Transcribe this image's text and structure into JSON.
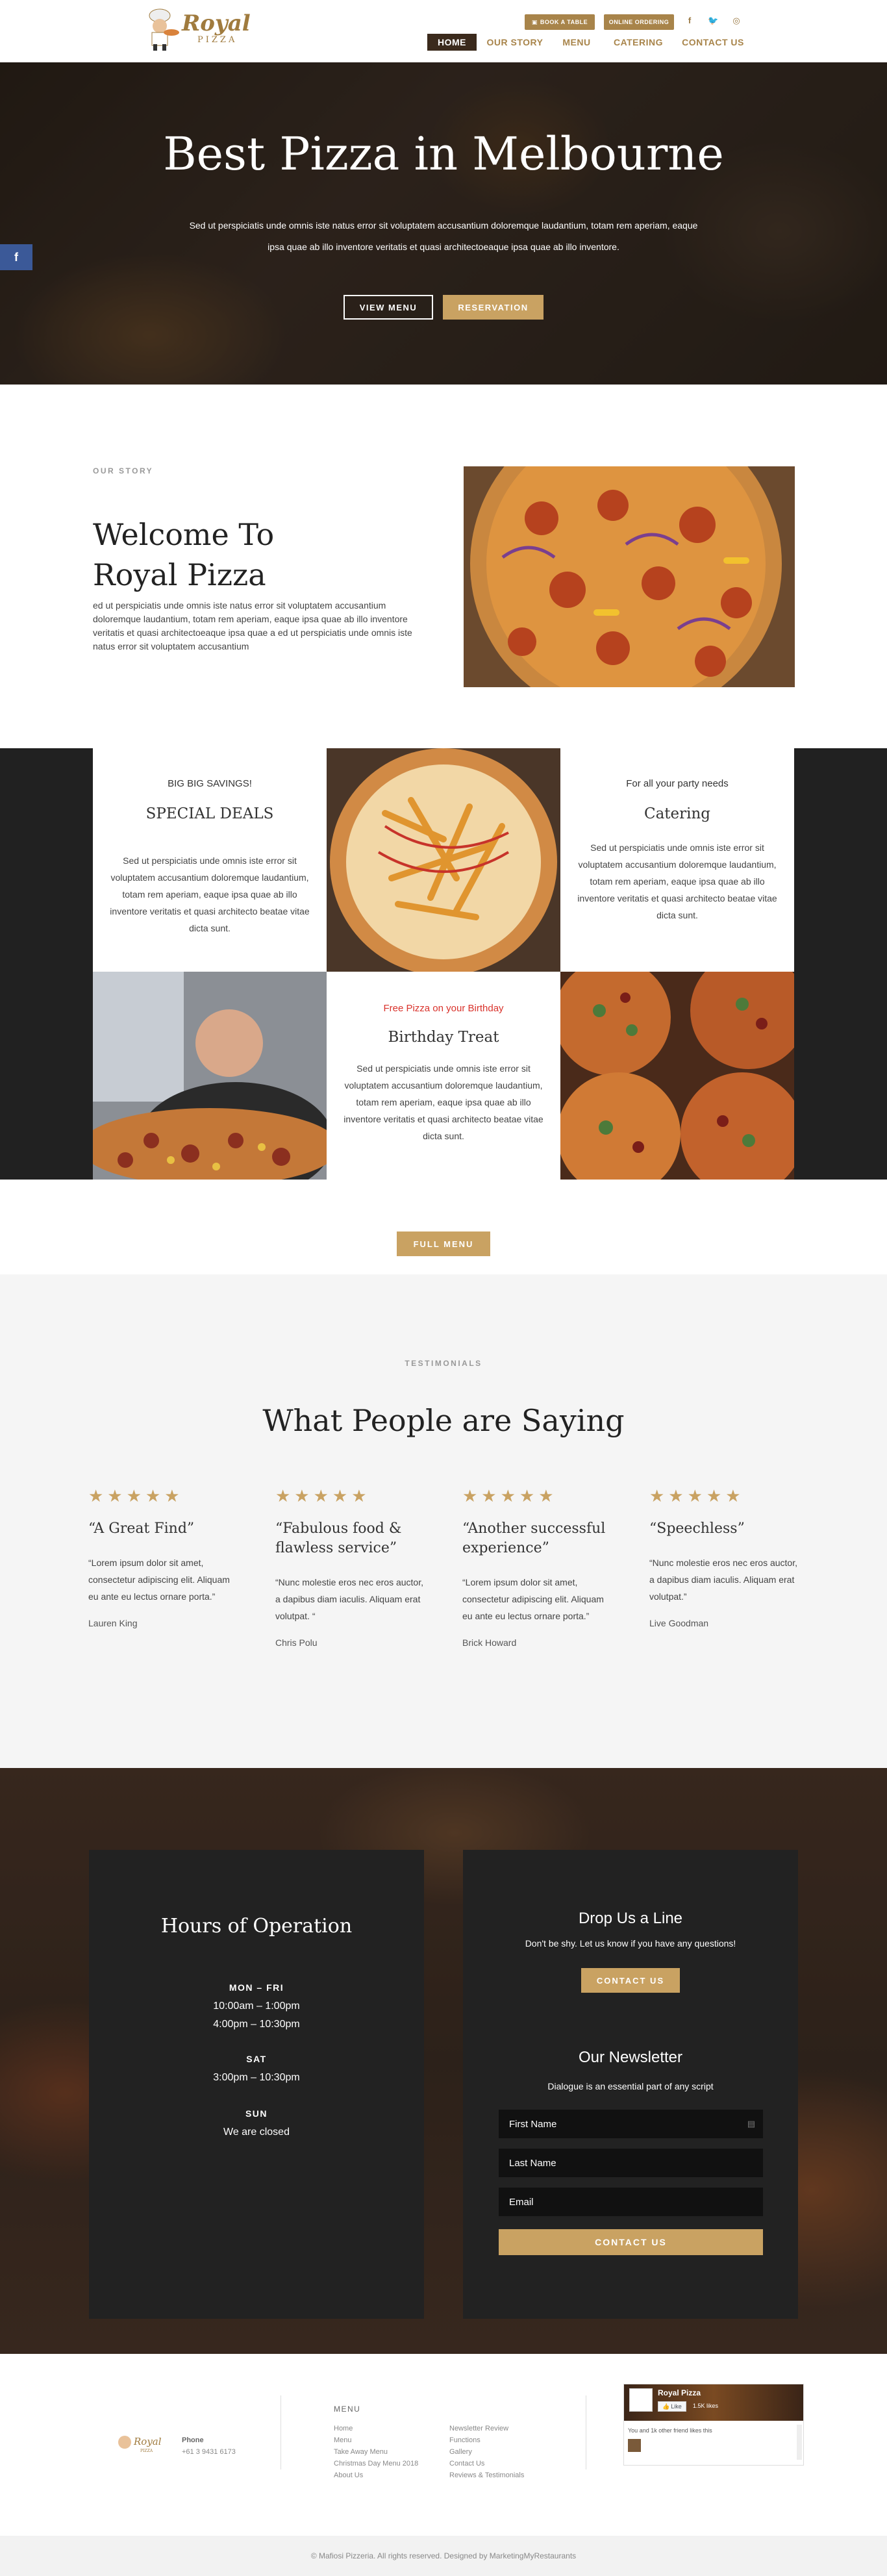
{
  "brand": {
    "logo_text": "Royal",
    "logo_sub": "PIZZA"
  },
  "header": {
    "book_table": "BOOK A TABLE",
    "online_ordering": "ONLINE ORDERING",
    "nav": [
      {
        "label": "HOME"
      },
      {
        "label": "OUR STORY"
      },
      {
        "label": "MENU"
      },
      {
        "label": "CATERING"
      },
      {
        "label": "CONTACT US"
      }
    ]
  },
  "hero": {
    "title": "Best Pizza in Melbourne",
    "text": "Sed ut perspiciatis unde omnis iste natus error sit voluptatem accusantium doloremque laudantium, totam rem aperiam, eaque ipsa quae ab illo inventore veritatis et quasi architectoeaque ipsa quae ab illo inventore.",
    "view_menu": "VIEW MENU",
    "reservation": "RESERVATION"
  },
  "story": {
    "eyebrow": "OUR STORY",
    "title_l1": "Welcome To",
    "title_l2": "Royal Pizza",
    "text": "ed ut perspiciatis unde omnis iste natus error sit voluptatem accusantium doloremque laudantium, totam rem aperiam, eaque ipsa quae ab illo inventore veritatis et quasi architectoeaque ipsa quae a ed ut perspiciatis unde omnis iste natus error sit voluptatem accusantium"
  },
  "services": {
    "special": {
      "kicker": "BIG BIG SAVINGS!",
      "title": "SPECIAL DEALS",
      "text": "Sed ut perspiciatis unde omnis iste error sit voluptatem accusantium doloremque laudantium, totam rem aperiam, eaque ipsa quae ab illo inventore veritatis et quasi architecto beatae vitae dicta sunt."
    },
    "catering": {
      "kicker": "For all your party needs",
      "title": "Catering",
      "text": "Sed ut perspiciatis unde omnis iste error sit voluptatem accusantium doloremque laudantium, totam rem aperiam, eaque ipsa quae ab illo inventore veritatis et quasi architecto beatae vitae dicta sunt."
    },
    "birthday": {
      "kicker": "Free Pizza on your Birthday",
      "title": "Birthday Treat",
      "text": "Sed ut perspiciatis unde omnis iste error sit voluptatem accusantium doloremque laudantium, totam rem aperiam, eaque ipsa quae ab illo inventore veritatis et quasi architecto beatae vitae dicta sunt."
    },
    "full_menu": "FULL MENU"
  },
  "testimonials": {
    "eyebrow": "TESTIMONIALS",
    "title": "What People are Saying",
    "items": [
      {
        "stars": "★★★★★",
        "title": "“A Great Find”",
        "text": "“Lorem ipsum dolor sit amet, consectetur adipiscing elit. Aliquam eu ante eu lectus ornare porta.”",
        "who": "Lauren King"
      },
      {
        "stars": "★★★★★",
        "title": "“Fabulous food & flawless service”",
        "text": "“Nunc molestie eros nec eros auctor, a dapibus diam iaculis. Aliquam erat volutpat. “",
        "who": "Chris Polu"
      },
      {
        "stars": "★★★★★",
        "title": "“Another successful experience”",
        "text": "“Lorem ipsum dolor sit amet, consectetur adipiscing elit. Aliquam eu ante eu lectus ornare porta.”",
        "who": "Brick Howard"
      },
      {
        "stars": "★★★★★",
        "title": "“Speechless”",
        "text": "“Nunc molestie eros nec eros auctor, a dapibus diam iaculis. Aliquam erat volutpat.”",
        "who": "Live Goodman"
      }
    ]
  },
  "hours": {
    "title": "Hours of Operation",
    "mon_fri": "MON – FRI",
    "mf_1": "10:00am – 1:00pm",
    "mf_2": "4:00pm – 10:30pm",
    "sat": "SAT",
    "sat_1": "3:00pm – 10:30pm",
    "sun": "SUN",
    "sun_1": "We are closed"
  },
  "contact": {
    "title": "Drop Us a Line",
    "sub": "Don't be shy. Let us know if you have any questions!",
    "btn": "CONTACT US",
    "news_title": "Our Newsletter",
    "news_sub": "Dialogue is an essential part of any script",
    "first": "First Name",
    "last": "Last Name",
    "email": "Email",
    "submit": "CONTACT US"
  },
  "footer": {
    "phone_label": "Phone",
    "phone": "+61 3 9431 6173",
    "menu_title": "MENU",
    "col1": [
      "Home",
      "Menu",
      "Take Away Menu",
      "Christmas Day Menu 2018",
      "About Us"
    ],
    "col2": [
      "Newsletter Review",
      "Functions",
      "Gallery",
      "Contact Us",
      "Reviews & Testimonials"
    ],
    "fb_name": "Royal Pizza",
    "fb_like": "Like",
    "fb_count": "1.5K likes",
    "fb_friends": "You and 1k other friend likes this",
    "copyright": "© Mafiosi Pizzeria. All rights reserved. Designed by MarketingMyRestaurants"
  }
}
